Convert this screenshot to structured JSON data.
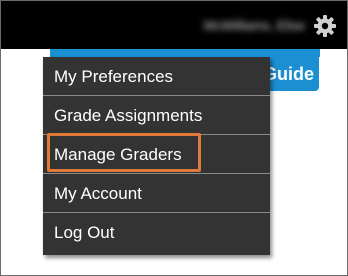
{
  "header": {
    "username": "McWilliams, Elise",
    "settings_icon": "gear-icon"
  },
  "guide_button": {
    "label": "Guide"
  },
  "menu": {
    "items": [
      {
        "label": "My Preferences"
      },
      {
        "label": "Grade Assignments"
      },
      {
        "label": "Manage Graders"
      },
      {
        "label": "My Account"
      },
      {
        "label": "Log Out"
      }
    ]
  },
  "colors": {
    "topbar": "#000000",
    "menu_bg": "#333333",
    "menu_divider": "#8a8a8a",
    "accent_blue": "#1b8fd2",
    "highlight": "#e07a3a"
  }
}
